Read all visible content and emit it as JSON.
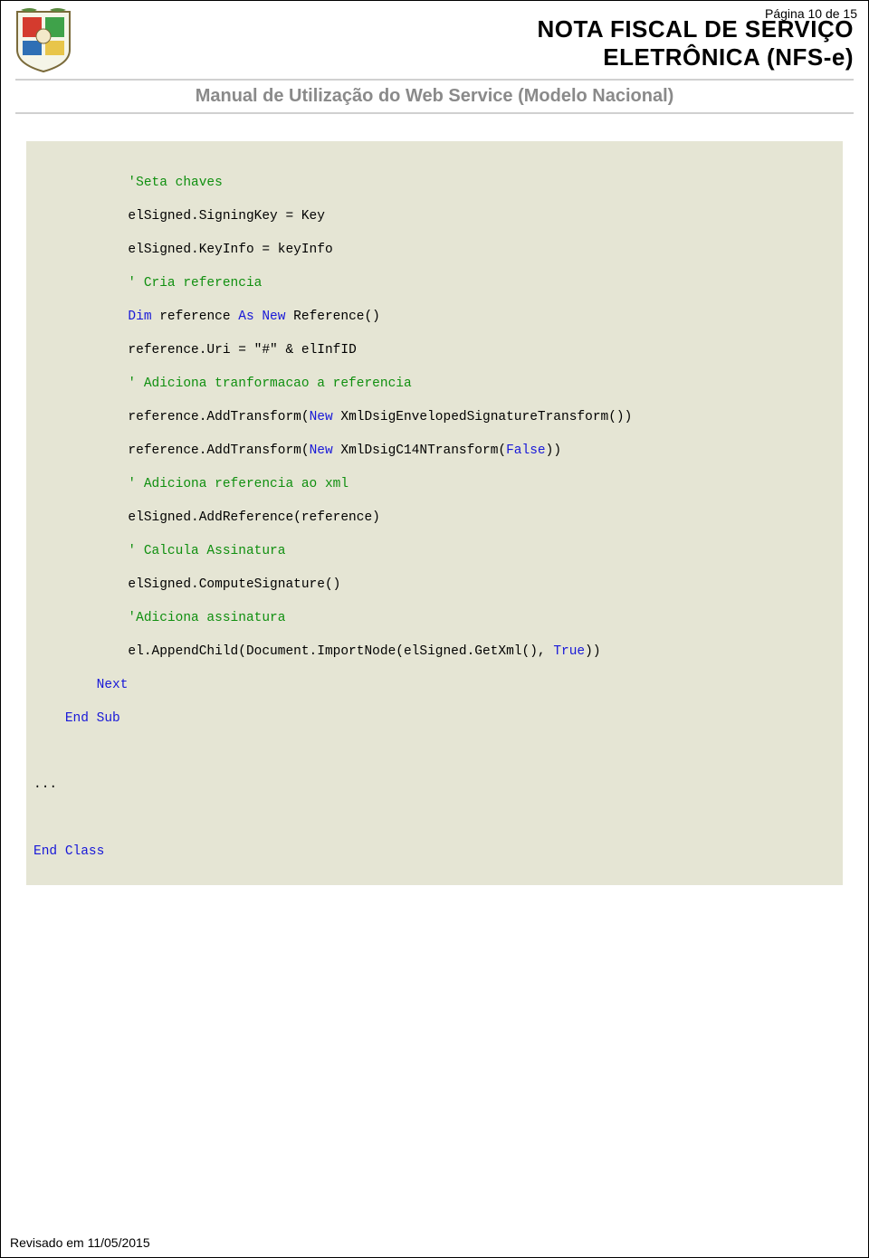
{
  "header": {
    "page_label": "Página 10 de 15",
    "title_line1": "NOTA FISCAL DE SERVIÇO",
    "title_line2": "ELETRÔNICA (NFS-e)",
    "subtitle": "Manual de Utilização do Web Service (Modelo Nacional)"
  },
  "code": {
    "l1_cm": "'Seta chaves",
    "l2": "elSigned.SigningKey = Key",
    "l3": "elSigned.KeyInfo = keyInfo",
    "l4_cm": "' Cria referencia",
    "l5_kw1": "Dim",
    "l5_txt1": " reference ",
    "l5_kw2": "As",
    "l5_txt2": " ",
    "l5_kw3": "New",
    "l5_txt3": " Reference()",
    "l6_a": "reference.Uri = ",
    "l6_b": "\"#\"",
    "l6_c": " & elInfID",
    "l7_cm": "' Adiciona tranformacao a referencia",
    "l8_a": "reference.AddTransform(",
    "l8_kw": "New",
    "l8_b": " XmlDsigEnvelopedSignatureTransform())",
    "l9_a": "reference.AddTransform(",
    "l9_kw1": "New",
    "l9_b": " XmlDsigC14NTransform(",
    "l9_kw2": "False",
    "l9_c": "))",
    "l10_cm": "' Adiciona referencia ao xml",
    "l11": "elSigned.AddReference(reference)",
    "l12_cm": "' Calcula Assinatura",
    "l13": "elSigned.ComputeSignature()",
    "l14_cm": "'Adiciona assinatura",
    "l15_a": "el.AppendChild(Document.ImportNode(elSigned.GetXml(), ",
    "l15_kw": "True",
    "l15_b": "))",
    "l16_kw": "Next",
    "l17_kw1": "End",
    "l17_kw2": "Sub",
    "l18": "...",
    "l19_kw1": "End",
    "l19_kw2": "Class"
  },
  "footer": {
    "revised": "Revisado em 11/05/2015"
  }
}
